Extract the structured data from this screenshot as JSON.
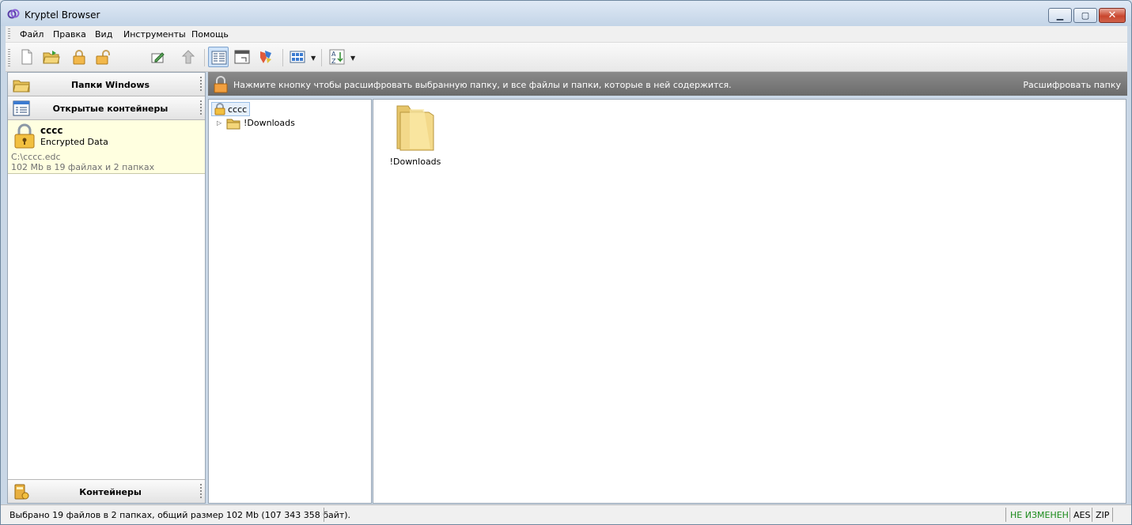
{
  "window": {
    "title": "Kryptel Browser"
  },
  "menu": [
    "Файл",
    "Правка",
    "Вид",
    "Инструменты",
    "Помощь"
  ],
  "toolbar": {
    "icons": [
      "new-file-icon",
      "open-folder-icon",
      "lock-icon",
      "unlock-icon",
      "edit-icon",
      "up-arrow-icon",
      "details-view-icon",
      "window-icon",
      "properties-icon",
      "thumbnails-view-icon",
      "sort-icon"
    ]
  },
  "left_panel": {
    "windows_folders": "Папки Windows",
    "open_containers": "Открытые контейнеры",
    "containers": "Контейнеры",
    "entry": {
      "name": "cccc",
      "description": "Encrypted Data",
      "path": "C:\\cccc.edc",
      "size": "102 Mb в 19 файлах и 2 папках"
    }
  },
  "infobar": {
    "message": "Нажмите кнопку чтобы расшифровать выбранную папку, и все файлы и папки, которые в ней содержится.",
    "action": "Расшифровать папку"
  },
  "tree": {
    "root": "cccc",
    "children": [
      "!Downloads"
    ]
  },
  "files": [
    {
      "name": "!Downloads",
      "icon": "folder-icon"
    }
  ],
  "status": {
    "text": "Выбрано 19 файлов в 2 папках, общий размер 102 Mb (107 343 358 байт).",
    "state": "НЕ ИЗМЕНЕН",
    "cipher": "AES",
    "compression": "ZIP"
  },
  "colors": {
    "accent": "#7da2ce",
    "state_ok": "#1a8a1a",
    "entry_bg": "#ffffe0"
  }
}
